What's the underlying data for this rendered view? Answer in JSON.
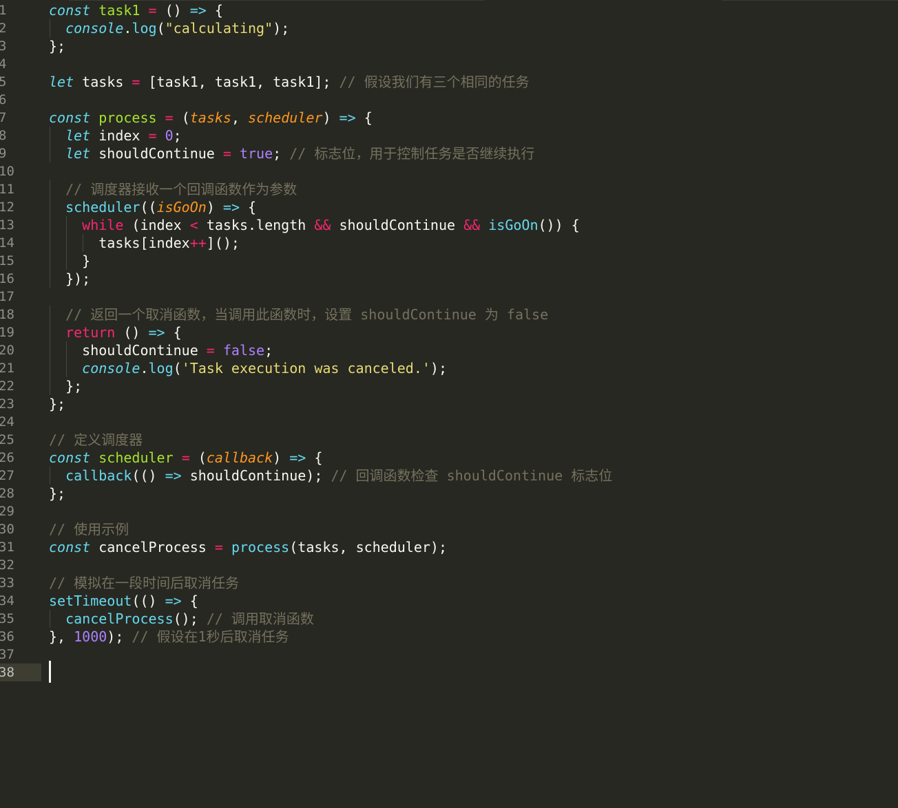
{
  "editor": {
    "theme": "monokai",
    "current_line": 38,
    "colors": {
      "background": "#272822",
      "keyword": "#66d9ef",
      "operator": "#f92672",
      "function_name": "#a6e22e",
      "parameter": "#fd971f",
      "string": "#e6db74",
      "number": "#ae81ff",
      "comment": "#75715e",
      "text": "#f8f8f2"
    },
    "line_numbers": [
      "1",
      "2",
      "3",
      "4",
      "5",
      "6",
      "7",
      "8",
      "9",
      "10",
      "11",
      "12",
      "13",
      "14",
      "15",
      "16",
      "17",
      "18",
      "19",
      "20",
      "21",
      "22",
      "23",
      "24",
      "25",
      "26",
      "27",
      "28",
      "29",
      "30",
      "31",
      "32",
      "33",
      "34",
      "35",
      "36",
      "37",
      "38"
    ],
    "lines": [
      {
        "n": 1,
        "indent": 0,
        "tokens": [
          {
            "t": "const",
            "c": "kw"
          },
          {
            "t": " ",
            "c": "pl"
          },
          {
            "t": "task1",
            "c": "fn"
          },
          {
            "t": " ",
            "c": "pl"
          },
          {
            "t": "=",
            "c": "op"
          },
          {
            "t": " () ",
            "c": "pl"
          },
          {
            "t": "=>",
            "c": "kw"
          },
          {
            "t": " {",
            "c": "pl"
          }
        ]
      },
      {
        "n": 2,
        "indent": 1,
        "tokens": [
          {
            "t": "  ",
            "c": "pl"
          },
          {
            "t": "console",
            "c": "bi"
          },
          {
            "t": ".",
            "c": "pl"
          },
          {
            "t": "log",
            "c": "call"
          },
          {
            "t": "(",
            "c": "pl"
          },
          {
            "t": "\"calculating\"",
            "c": "str"
          },
          {
            "t": ");",
            "c": "pl"
          }
        ]
      },
      {
        "n": 3,
        "indent": 0,
        "tokens": [
          {
            "t": "};",
            "c": "pl"
          }
        ]
      },
      {
        "n": 4,
        "indent": 0,
        "tokens": []
      },
      {
        "n": 5,
        "indent": 0,
        "tokens": [
          {
            "t": "let",
            "c": "kw"
          },
          {
            "t": " tasks ",
            "c": "pl"
          },
          {
            "t": "=",
            "c": "op"
          },
          {
            "t": " [task1, task1, task1]; ",
            "c": "pl"
          },
          {
            "t": "// 假设我们有三个相同的任务",
            "c": "cmt"
          }
        ]
      },
      {
        "n": 6,
        "indent": 0,
        "tokens": []
      },
      {
        "n": 7,
        "indent": 0,
        "tokens": [
          {
            "t": "const",
            "c": "kw"
          },
          {
            "t": " ",
            "c": "pl"
          },
          {
            "t": "process",
            "c": "fn"
          },
          {
            "t": " ",
            "c": "pl"
          },
          {
            "t": "=",
            "c": "op"
          },
          {
            "t": " (",
            "c": "pl"
          },
          {
            "t": "tasks",
            "c": "prm"
          },
          {
            "t": ", ",
            "c": "pl"
          },
          {
            "t": "scheduler",
            "c": "prm"
          },
          {
            "t": ") ",
            "c": "pl"
          },
          {
            "t": "=>",
            "c": "kw"
          },
          {
            "t": " {",
            "c": "pl"
          }
        ]
      },
      {
        "n": 8,
        "indent": 1,
        "tokens": [
          {
            "t": "  ",
            "c": "pl"
          },
          {
            "t": "let",
            "c": "kw"
          },
          {
            "t": " index ",
            "c": "pl"
          },
          {
            "t": "=",
            "c": "op"
          },
          {
            "t": " ",
            "c": "pl"
          },
          {
            "t": "0",
            "c": "num"
          },
          {
            "t": ";",
            "c": "pl"
          }
        ]
      },
      {
        "n": 9,
        "indent": 1,
        "tokens": [
          {
            "t": "  ",
            "c": "pl"
          },
          {
            "t": "let",
            "c": "kw"
          },
          {
            "t": " shouldContinue ",
            "c": "pl"
          },
          {
            "t": "=",
            "c": "op"
          },
          {
            "t": " ",
            "c": "pl"
          },
          {
            "t": "true",
            "c": "num"
          },
          {
            "t": "; ",
            "c": "pl"
          },
          {
            "t": "// 标志位，用于控制任务是否继续执行",
            "c": "cmt"
          }
        ]
      },
      {
        "n": 10,
        "indent": 0,
        "tokens": []
      },
      {
        "n": 11,
        "indent": 1,
        "tokens": [
          {
            "t": "  ",
            "c": "pl"
          },
          {
            "t": "// 调度器接收一个回调函数作为参数",
            "c": "cmt"
          }
        ]
      },
      {
        "n": 12,
        "indent": 1,
        "tokens": [
          {
            "t": "  ",
            "c": "pl"
          },
          {
            "t": "scheduler",
            "c": "call"
          },
          {
            "t": "((",
            "c": "pl"
          },
          {
            "t": "isGoOn",
            "c": "prm"
          },
          {
            "t": ") ",
            "c": "pl"
          },
          {
            "t": "=>",
            "c": "kw"
          },
          {
            "t": " {",
            "c": "pl"
          }
        ]
      },
      {
        "n": 13,
        "indent": 2,
        "tokens": [
          {
            "t": "    ",
            "c": "pl"
          },
          {
            "t": "while",
            "c": "kw2"
          },
          {
            "t": " (index ",
            "c": "pl"
          },
          {
            "t": "<",
            "c": "op"
          },
          {
            "t": " tasks.length ",
            "c": "pl"
          },
          {
            "t": "&&",
            "c": "op"
          },
          {
            "t": " shouldContinue ",
            "c": "pl"
          },
          {
            "t": "&&",
            "c": "op"
          },
          {
            "t": " ",
            "c": "pl"
          },
          {
            "t": "isGoOn",
            "c": "call"
          },
          {
            "t": "()) {",
            "c": "pl"
          }
        ]
      },
      {
        "n": 14,
        "indent": 3,
        "tokens": [
          {
            "t": "      tasks[index",
            "c": "pl"
          },
          {
            "t": "++",
            "c": "op"
          },
          {
            "t": "]();",
            "c": "pl"
          }
        ]
      },
      {
        "n": 15,
        "indent": 2,
        "tokens": [
          {
            "t": "    }",
            "c": "pl"
          }
        ]
      },
      {
        "n": 16,
        "indent": 1,
        "tokens": [
          {
            "t": "  });",
            "c": "pl"
          }
        ]
      },
      {
        "n": 17,
        "indent": 0,
        "tokens": []
      },
      {
        "n": 18,
        "indent": 1,
        "tokens": [
          {
            "t": "  ",
            "c": "pl"
          },
          {
            "t": "// 返回一个取消函数，当调用此函数时，设置 shouldContinue 为 false",
            "c": "cmt"
          }
        ]
      },
      {
        "n": 19,
        "indent": 1,
        "tokens": [
          {
            "t": "  ",
            "c": "pl"
          },
          {
            "t": "return",
            "c": "kw2"
          },
          {
            "t": " () ",
            "c": "pl"
          },
          {
            "t": "=>",
            "c": "kw"
          },
          {
            "t": " {",
            "c": "pl"
          }
        ]
      },
      {
        "n": 20,
        "indent": 2,
        "tokens": [
          {
            "t": "    shouldContinue ",
            "c": "pl"
          },
          {
            "t": "=",
            "c": "op"
          },
          {
            "t": " ",
            "c": "pl"
          },
          {
            "t": "false",
            "c": "num"
          },
          {
            "t": ";",
            "c": "pl"
          }
        ]
      },
      {
        "n": 21,
        "indent": 2,
        "tokens": [
          {
            "t": "    ",
            "c": "pl"
          },
          {
            "t": "console",
            "c": "bi"
          },
          {
            "t": ".",
            "c": "pl"
          },
          {
            "t": "log",
            "c": "call"
          },
          {
            "t": "(",
            "c": "pl"
          },
          {
            "t": "'Task execution was canceled.'",
            "c": "str"
          },
          {
            "t": ");",
            "c": "pl"
          }
        ]
      },
      {
        "n": 22,
        "indent": 1,
        "tokens": [
          {
            "t": "  };",
            "c": "pl"
          }
        ]
      },
      {
        "n": 23,
        "indent": 0,
        "tokens": [
          {
            "t": "};",
            "c": "pl"
          }
        ]
      },
      {
        "n": 24,
        "indent": 0,
        "tokens": []
      },
      {
        "n": 25,
        "indent": 0,
        "tokens": [
          {
            "t": "// 定义调度器",
            "c": "cmt"
          }
        ]
      },
      {
        "n": 26,
        "indent": 0,
        "tokens": [
          {
            "t": "const",
            "c": "kw"
          },
          {
            "t": " ",
            "c": "pl"
          },
          {
            "t": "scheduler",
            "c": "fn"
          },
          {
            "t": " ",
            "c": "pl"
          },
          {
            "t": "=",
            "c": "op"
          },
          {
            "t": " (",
            "c": "pl"
          },
          {
            "t": "callback",
            "c": "prm"
          },
          {
            "t": ") ",
            "c": "pl"
          },
          {
            "t": "=>",
            "c": "kw"
          },
          {
            "t": " {",
            "c": "pl"
          }
        ]
      },
      {
        "n": 27,
        "indent": 1,
        "tokens": [
          {
            "t": "  ",
            "c": "pl"
          },
          {
            "t": "callback",
            "c": "call"
          },
          {
            "t": "(() ",
            "c": "pl"
          },
          {
            "t": "=>",
            "c": "kw"
          },
          {
            "t": " shouldContinue); ",
            "c": "pl"
          },
          {
            "t": "// 回调函数检查 shouldContinue 标志位",
            "c": "cmt"
          }
        ]
      },
      {
        "n": 28,
        "indent": 0,
        "tokens": [
          {
            "t": "};",
            "c": "pl"
          }
        ]
      },
      {
        "n": 29,
        "indent": 0,
        "tokens": []
      },
      {
        "n": 30,
        "indent": 0,
        "tokens": [
          {
            "t": "// 使用示例",
            "c": "cmt"
          }
        ]
      },
      {
        "n": 31,
        "indent": 0,
        "tokens": [
          {
            "t": "const",
            "c": "kw"
          },
          {
            "t": " cancelProcess ",
            "c": "pl"
          },
          {
            "t": "=",
            "c": "op"
          },
          {
            "t": " ",
            "c": "pl"
          },
          {
            "t": "process",
            "c": "call"
          },
          {
            "t": "(tasks, scheduler);",
            "c": "pl"
          }
        ]
      },
      {
        "n": 32,
        "indent": 0,
        "tokens": []
      },
      {
        "n": 33,
        "indent": 0,
        "tokens": [
          {
            "t": "// 模拟在一段时间后取消任务",
            "c": "cmt"
          }
        ]
      },
      {
        "n": 34,
        "indent": 0,
        "tokens": [
          {
            "t": "setTimeout",
            "c": "call"
          },
          {
            "t": "(() ",
            "c": "pl"
          },
          {
            "t": "=>",
            "c": "kw"
          },
          {
            "t": " {",
            "c": "pl"
          }
        ]
      },
      {
        "n": 35,
        "indent": 1,
        "tokens": [
          {
            "t": "  ",
            "c": "pl"
          },
          {
            "t": "cancelProcess",
            "c": "call"
          },
          {
            "t": "(); ",
            "c": "pl"
          },
          {
            "t": "// 调用取消函数",
            "c": "cmt"
          }
        ]
      },
      {
        "n": 36,
        "indent": 0,
        "tokens": [
          {
            "t": "}, ",
            "c": "pl"
          },
          {
            "t": "1000",
            "c": "num"
          },
          {
            "t": "); ",
            "c": "pl"
          },
          {
            "t": "// 假设在1秒后取消任务",
            "c": "cmt"
          }
        ]
      },
      {
        "n": 37,
        "indent": 0,
        "tokens": []
      },
      {
        "n": 38,
        "indent": 0,
        "tokens": [],
        "cursor": true
      }
    ]
  }
}
